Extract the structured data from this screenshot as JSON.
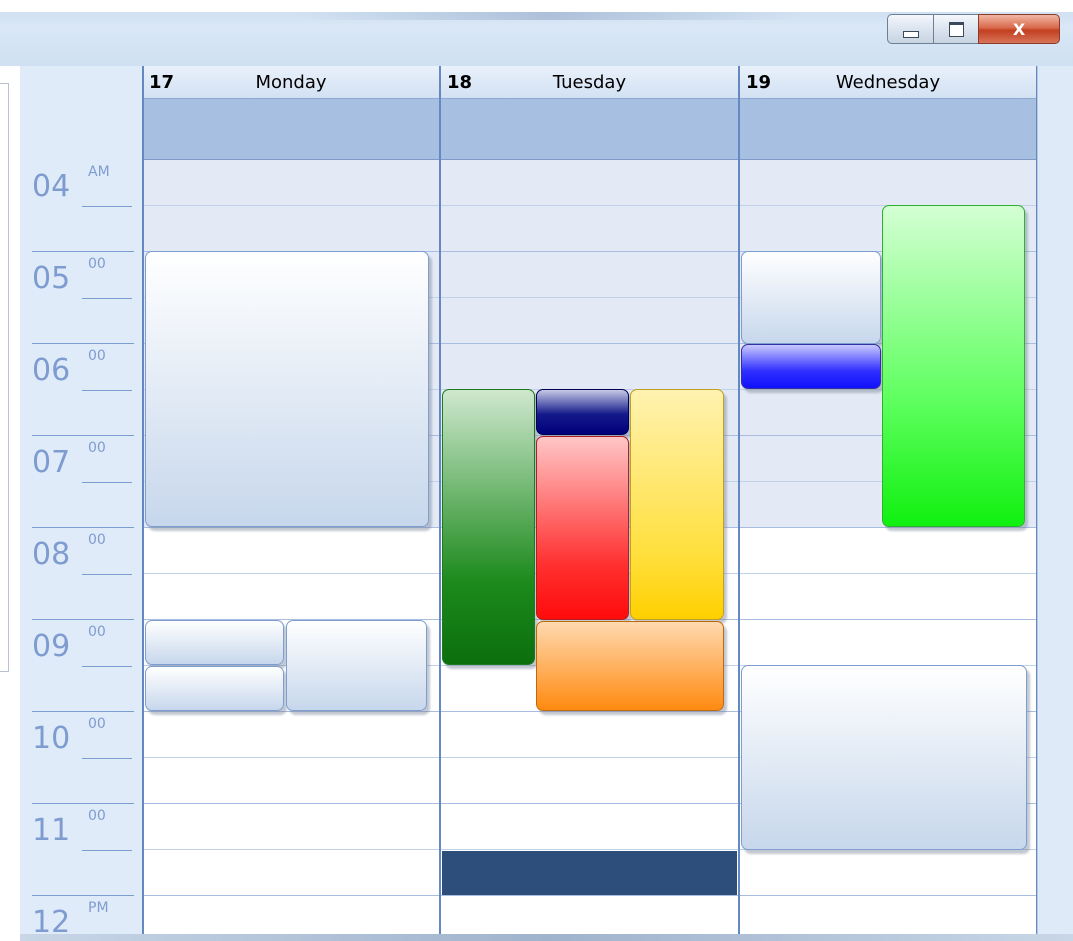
{
  "window": {
    "buttons": [
      "minimize",
      "maximize",
      "close"
    ],
    "close_glyph": "X"
  },
  "timescale": {
    "hours": [
      {
        "hour": "04",
        "suffix": "AM"
      },
      {
        "hour": "05",
        "suffix": "00"
      },
      {
        "hour": "06",
        "suffix": "00"
      },
      {
        "hour": "07",
        "suffix": "00"
      },
      {
        "hour": "08",
        "suffix": "00"
      },
      {
        "hour": "09",
        "suffix": "00"
      },
      {
        "hour": "10",
        "suffix": "00"
      },
      {
        "hour": "11",
        "suffix": "00"
      },
      {
        "hour": "12",
        "suffix": "PM"
      }
    ]
  },
  "days": [
    {
      "num": "17",
      "name": "Monday"
    },
    {
      "num": "18",
      "name": "Tuesday"
    },
    {
      "num": "19",
      "name": "Wednesday"
    }
  ],
  "colors": {
    "appointment_default": "#c7d7ec",
    "green_dark": "#0c6f0c",
    "navy": "#00007a",
    "red": "#ff0b0b",
    "yellow": "#ffd000",
    "orange": "#ff8a10",
    "blue_bright": "#1010ff",
    "green_bright": "#10f010",
    "selected_slot": "#2d4e7a"
  }
}
